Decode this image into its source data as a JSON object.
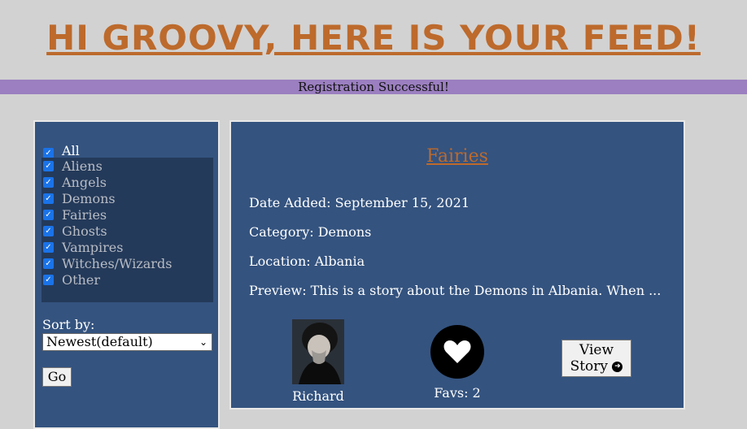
{
  "header": {
    "title": "HI GROOVY, HERE IS YOUR FEED!"
  },
  "banner": {
    "message": "Registration Successful!"
  },
  "sidebar": {
    "all_label": "All",
    "categories": [
      "Aliens",
      "Angels",
      "Demons",
      "Fairies",
      "Ghosts",
      "Vampires",
      "Witches/Wizards",
      "Other"
    ],
    "sort_label": "Sort by:",
    "sort_selected": "Newest(default)",
    "go_label": "Go"
  },
  "story": {
    "title": "Fairies",
    "date_added": "Date Added: September 15, 2021",
    "category": "Category: Demons",
    "location": "Location: Albania",
    "preview": "Preview: This is a story about the Demons in Albania. When ...",
    "author": "Richard",
    "favs": "Favs: 2",
    "view_label_1": "View",
    "view_label_2": "Story"
  },
  "colors": {
    "accent": "#bd6a2c",
    "banner": "#9b7fc0",
    "panel": "#34537f"
  },
  "icons": {
    "heart": "heart-icon",
    "arrow": "arrow-right-circle-icon"
  }
}
